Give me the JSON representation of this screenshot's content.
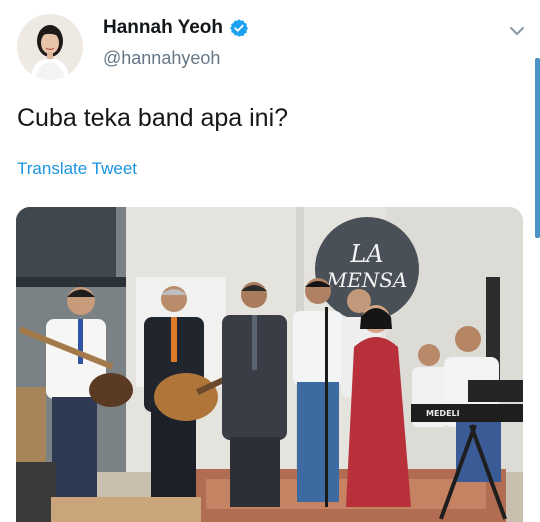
{
  "author": {
    "display_name": "Hannah Yeoh",
    "handle": "@hannahyeoh",
    "verified": true,
    "icons": {
      "verified": "verified-badge-icon",
      "menu": "chevron-down-icon"
    }
  },
  "tweet": {
    "text": "Cuba teka band apa ini?",
    "translate_label": "Translate Tweet"
  },
  "media": {
    "sign_line1": "LA",
    "sign_line2": "MENSA",
    "keyboard_brand": "MEDELI"
  },
  "colors": {
    "link": "#1b95e0",
    "verified": "#1da1f2",
    "handle": "#657786"
  }
}
